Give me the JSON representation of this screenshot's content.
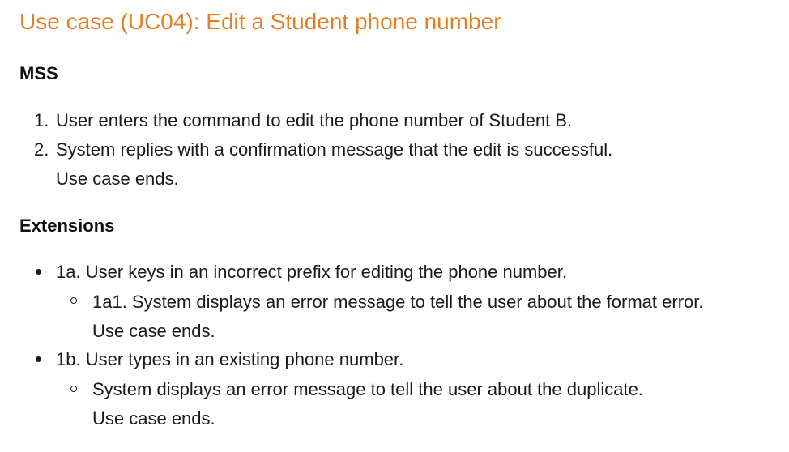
{
  "title": "Use case (UC04): Edit a Student phone number",
  "mss": {
    "heading": "MSS",
    "steps": [
      {
        "number": "1.",
        "text": "User enters the command to edit the phone number of Student B."
      },
      {
        "number": "2.",
        "text": "System replies with a confirmation message that the edit is successful.",
        "note": "Use case ends."
      }
    ]
  },
  "extensions": {
    "heading": "Extensions",
    "items": [
      {
        "text": "1a. User keys in an incorrect prefix for editing the phone number.",
        "sub": [
          {
            "text": "1a1. System displays an error message to tell the user about the format error.",
            "note": "Use case ends."
          }
        ]
      },
      {
        "text": "1b. User types in an existing phone number.",
        "sub": [
          {
            "text": "System displays an error message to tell the user about the duplicate.",
            "note": "Use case ends."
          }
        ]
      }
    ]
  }
}
